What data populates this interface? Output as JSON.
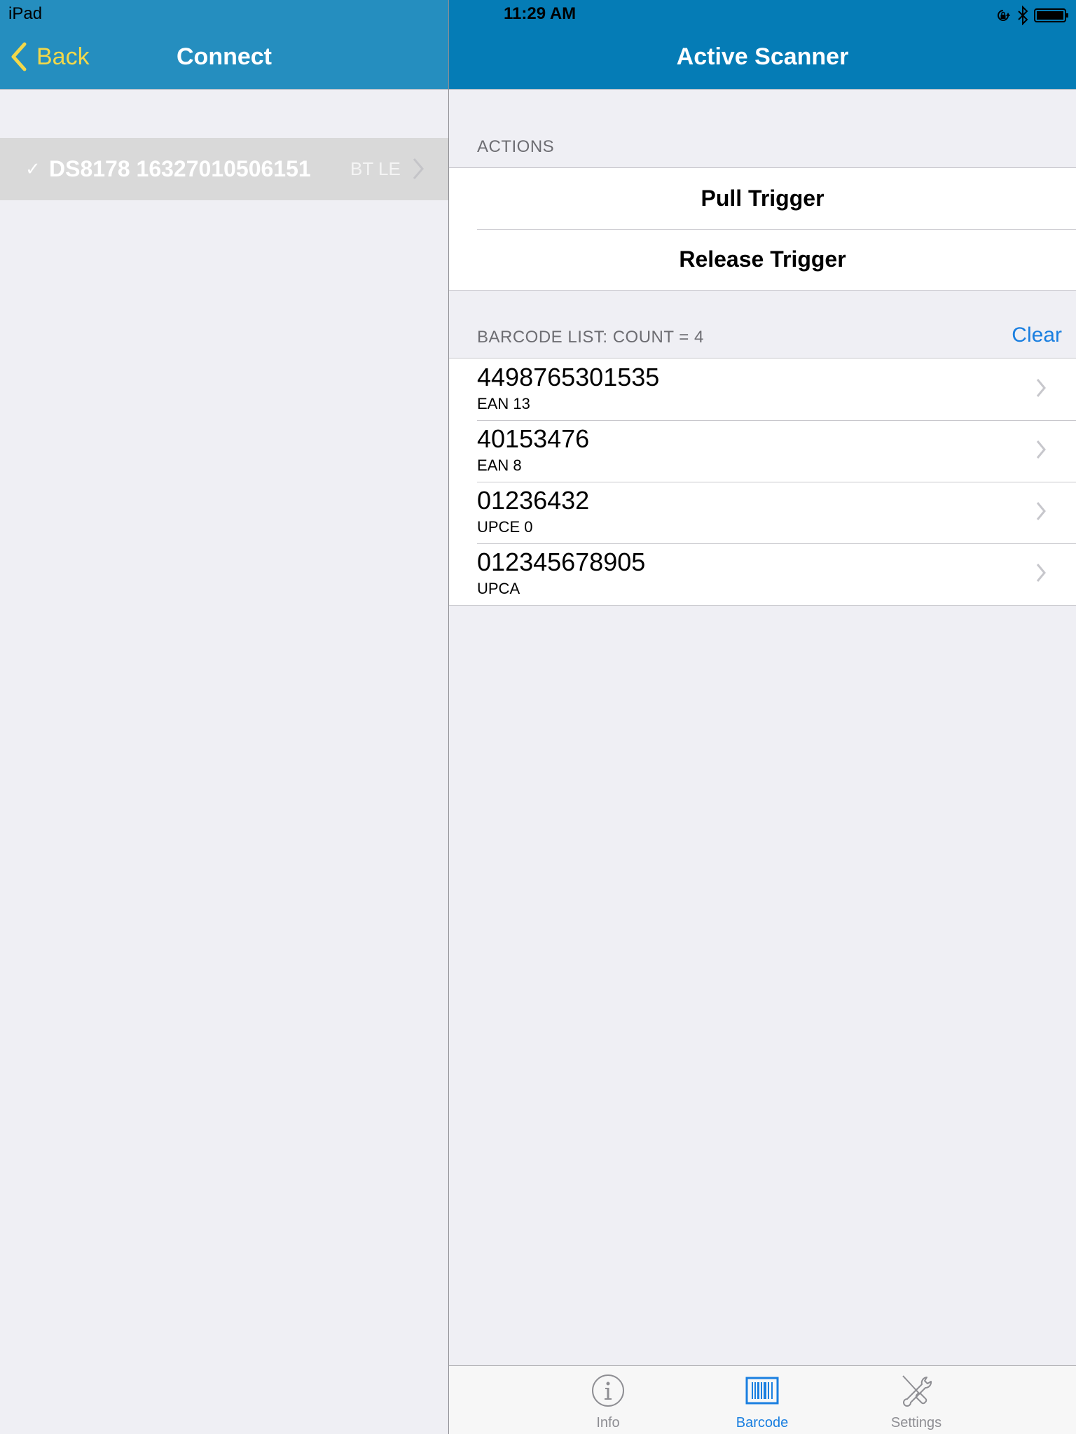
{
  "status_bar": {
    "device": "iPad",
    "time": "11:29 AM",
    "icons": [
      "rotation-lock-icon",
      "bluetooth-icon",
      "battery-icon"
    ]
  },
  "master": {
    "back_label": "Back",
    "title": "Connect",
    "devices": [
      {
        "checkmark": "✓",
        "name": "DS8178 16327010506151",
        "connection": "BT LE",
        "selected": true
      }
    ]
  },
  "detail": {
    "title": "Active Scanner",
    "actions_header": "ACTIONS",
    "actions": [
      {
        "label": "Pull Trigger"
      },
      {
        "label": "Release Trigger"
      }
    ],
    "barcode_header": "BARCODE LIST: COUNT = 4",
    "clear_label": "Clear",
    "barcodes": [
      {
        "value": "4498765301535",
        "type": "EAN 13"
      },
      {
        "value": "40153476",
        "type": "EAN 8"
      },
      {
        "value": "01236432",
        "type": "UPCE 0"
      },
      {
        "value": "012345678905",
        "type": "UPCA"
      }
    ]
  },
  "tabbar": {
    "tabs": [
      {
        "label": "Info",
        "icon": "info-icon",
        "active": false
      },
      {
        "label": "Barcode",
        "icon": "barcode-icon",
        "active": true
      },
      {
        "label": "Settings",
        "icon": "tools-icon",
        "active": false
      }
    ]
  },
  "colors": {
    "master_nav": "#258ebf",
    "detail_nav": "#057cb6",
    "back_accent": "#f2d84a",
    "tint": "#1a7fe0"
  }
}
